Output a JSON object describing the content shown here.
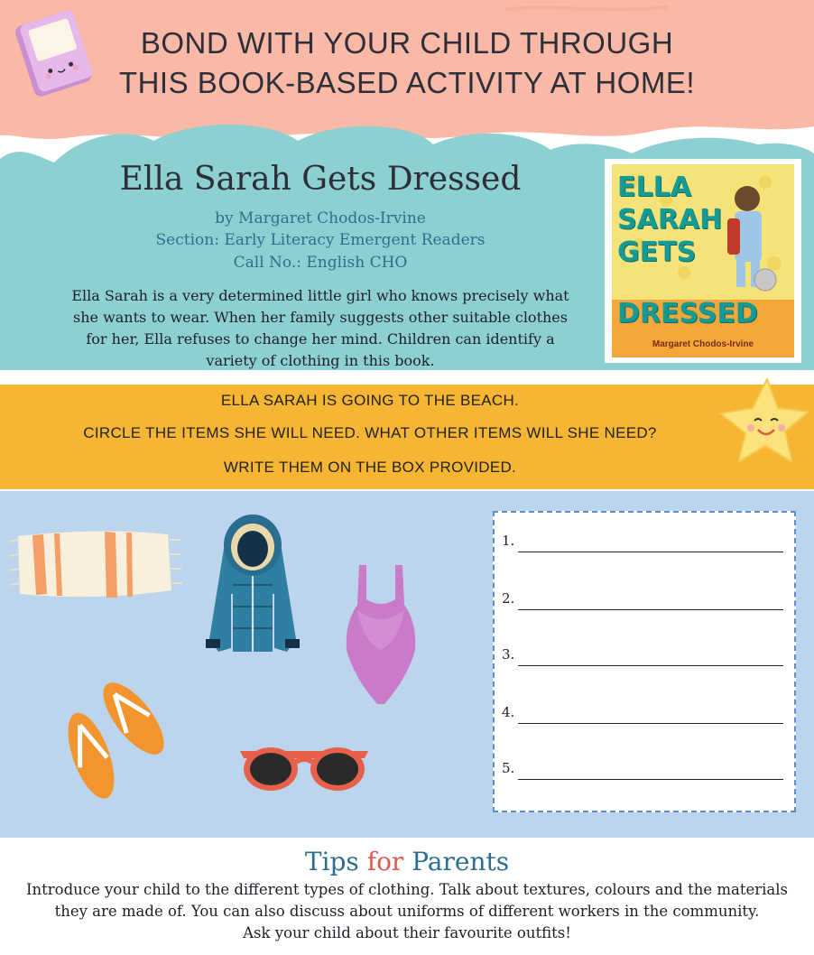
{
  "header": {
    "line1": "BOND WITH YOUR CHILD THROUGH",
    "line2": "THIS BOOK-BASED ACTIVITY AT HOME!"
  },
  "book": {
    "title": "Ella Sarah Gets Dressed",
    "author": "by Margaret Chodos-Irvine",
    "section": "Section: Early Literacy Emergent Readers",
    "call_no": "Call No.: English CHO",
    "summary": "Ella Sarah is a very determined little girl who knows precisely what she wants to wear. When her family suggests other suitable clothes for her, Ella refuses to change her mind. Children can identify a variety of clothing in this book.",
    "cover": {
      "title_words": [
        "ELLA",
        "SARAH",
        "GETS",
        "DRESSED"
      ],
      "author": "Margaret Chodos-Irvine"
    }
  },
  "instructions": {
    "line1": "ELLA SARAH IS GOING TO THE BEACH.",
    "line2": "CIRCLE THE ITEMS SHE WILL NEED.  WHAT OTHER ITEMS WILL SHE NEED?",
    "line3": "WRITE THEM ON THE BOX PROVIDED."
  },
  "items": [
    "towel-icon",
    "winter-jacket-icon",
    "swimsuit-icon",
    "flip-flops-icon",
    "sunglasses-icon"
  ],
  "answers": [
    "1.",
    "2.",
    "3.",
    "4.",
    "5."
  ],
  "tips": {
    "title_part1": "Tips ",
    "title_part2": "for",
    "title_part3": " Parents",
    "text_line1": "Introduce your child to the different types of clothing. Talk about textures, colours and the materials",
    "text_line2": "they are made of. You can also discuss about uniforms of different workers in the community.",
    "text_line3": "Ask your child about their favourite outfits!"
  },
  "colors": {
    "header": "#f9b9a6",
    "cloud": "#8dd0d1",
    "band": "#f6b532",
    "activity": "#bcd5ec",
    "accent_text": "#2b6f8f"
  }
}
